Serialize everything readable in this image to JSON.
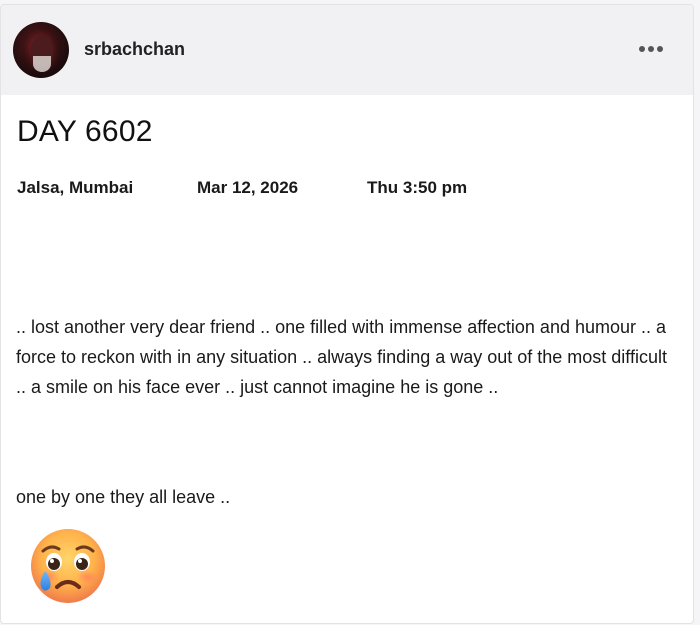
{
  "header": {
    "username": "srbachchan",
    "more_label": "•••"
  },
  "post": {
    "title": "DAY 6602",
    "location": "Jalsa, Mumbai",
    "date": "Mar 12,  2026",
    "time": "Thu  3:50 pm",
    "body": ".. lost another very dear friend .. one filled with immense affection and humour .. a force to reckon with in any situation .. always finding a way out of the most difficult  .. a smile on his face ever .. just cannot imagine he is gone ..",
    "closing": "one by one they all leave ..",
    "emoji": "sad-tear-face-icon"
  }
}
